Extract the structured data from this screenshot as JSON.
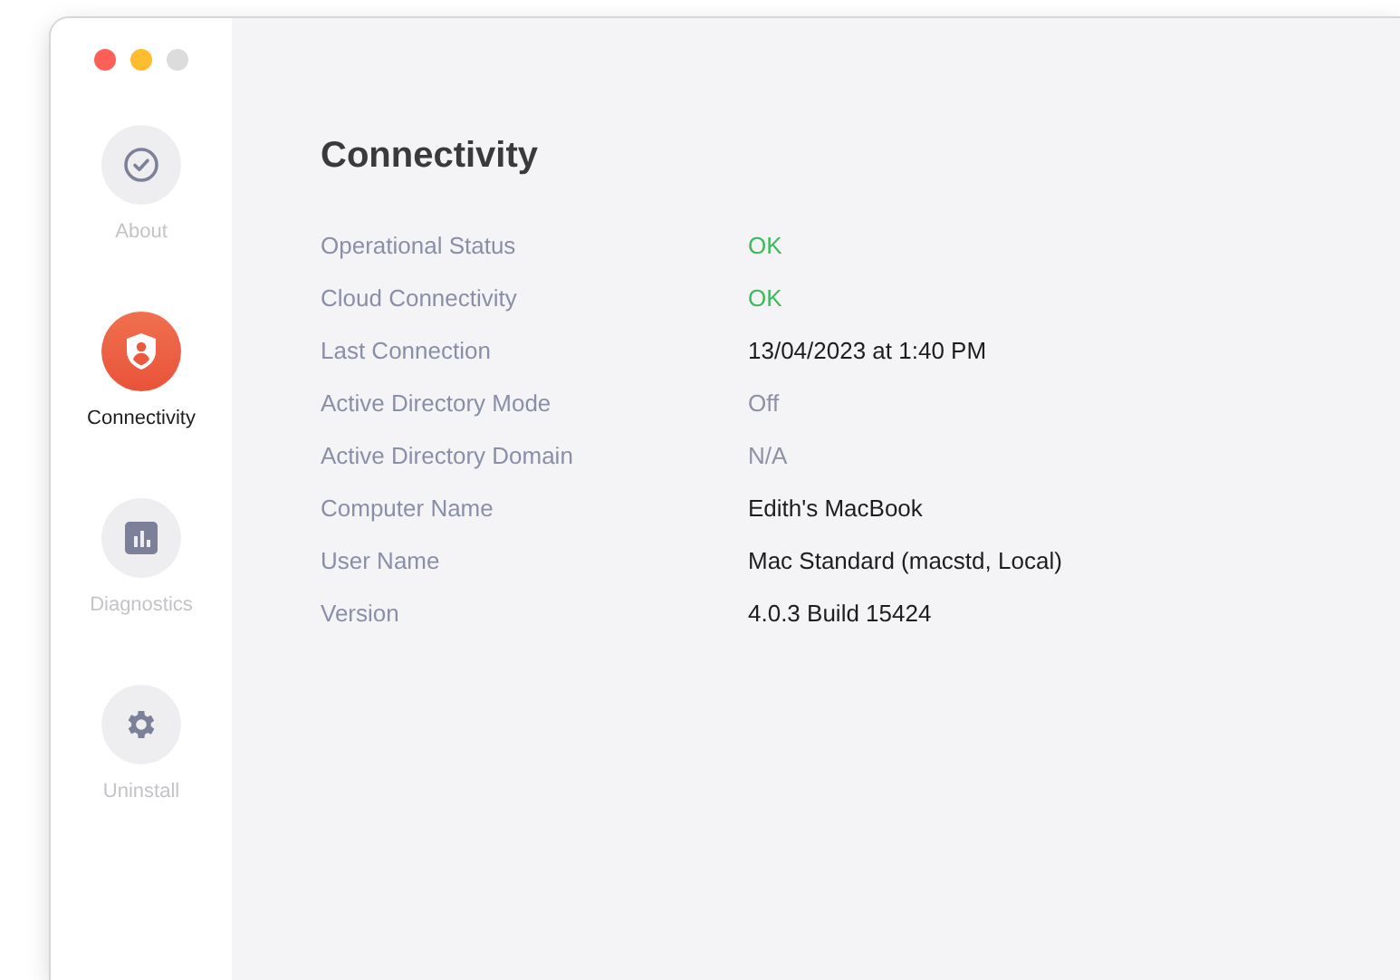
{
  "sidebar": {
    "items": [
      {
        "label": "About",
        "selected": false
      },
      {
        "label": "Connectivity",
        "selected": true
      },
      {
        "label": "Diagnostics",
        "selected": false
      },
      {
        "label": "Uninstall",
        "selected": false
      }
    ]
  },
  "content": {
    "title": "Connectivity",
    "rows": [
      {
        "label": "Operational Status",
        "value": "OK",
        "kind": "ok"
      },
      {
        "label": "Cloud Connectivity",
        "value": "OK",
        "kind": "ok"
      },
      {
        "label": "Last Connection",
        "value": "13/04/2023 at 1:40 PM",
        "kind": "plain"
      },
      {
        "label": "Active Directory Mode",
        "value": "Off",
        "kind": "muted"
      },
      {
        "label": "Active Directory Domain",
        "value": "N/A",
        "kind": "muted"
      },
      {
        "label": "Computer Name",
        "value": "Edith's MacBook",
        "kind": "plain"
      },
      {
        "label": "User Name",
        "value": "Mac Standard (macstd, Local)",
        "kind": "plain"
      },
      {
        "label": "Version",
        "value": "4.0.3 Build 15424",
        "kind": "plain"
      }
    ]
  }
}
